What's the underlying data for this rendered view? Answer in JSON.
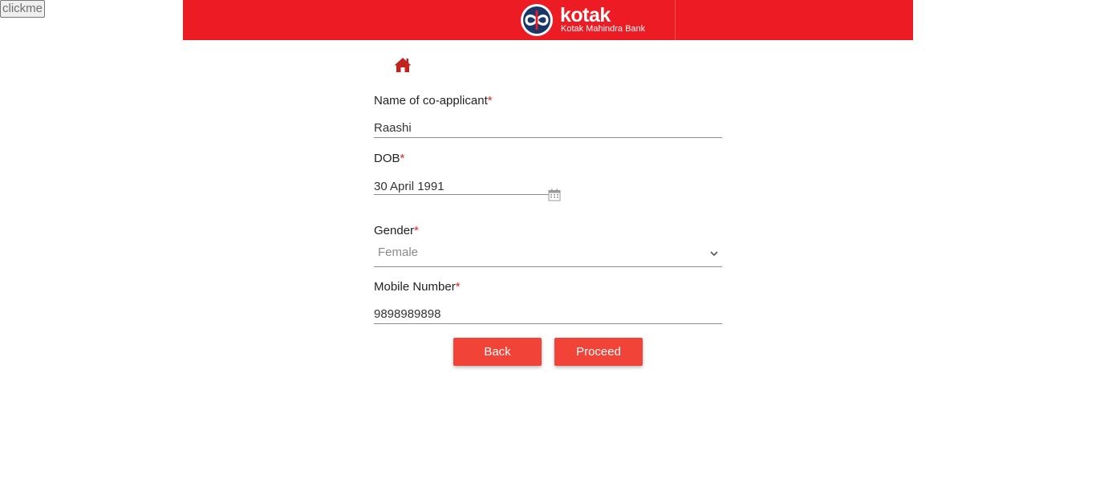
{
  "top_button": {
    "label": "clickme"
  },
  "header": {
    "brand_name": "kotak",
    "brand_sub": "Kotak Mahindra Bank",
    "bg_color": "#ed1c24"
  },
  "nav": {
    "home_icon": "home-icon"
  },
  "form": {
    "co_applicant_name": {
      "label": "Name of co-applicant",
      "required_mark": "*",
      "value": "Raashi"
    },
    "dob": {
      "label": "DOB",
      "required_mark": "*",
      "value": "30 April 1991",
      "icon": "calendar-icon"
    },
    "gender": {
      "label": "Gender",
      "required_mark": "*",
      "selected": "Female",
      "icon": "chevron-down-icon"
    },
    "mobile": {
      "label": "Mobile Number",
      "required_mark": "*",
      "value": "9898989898"
    }
  },
  "actions": {
    "back_label": "Back",
    "proceed_label": "Proceed",
    "button_color": "#f14338"
  }
}
